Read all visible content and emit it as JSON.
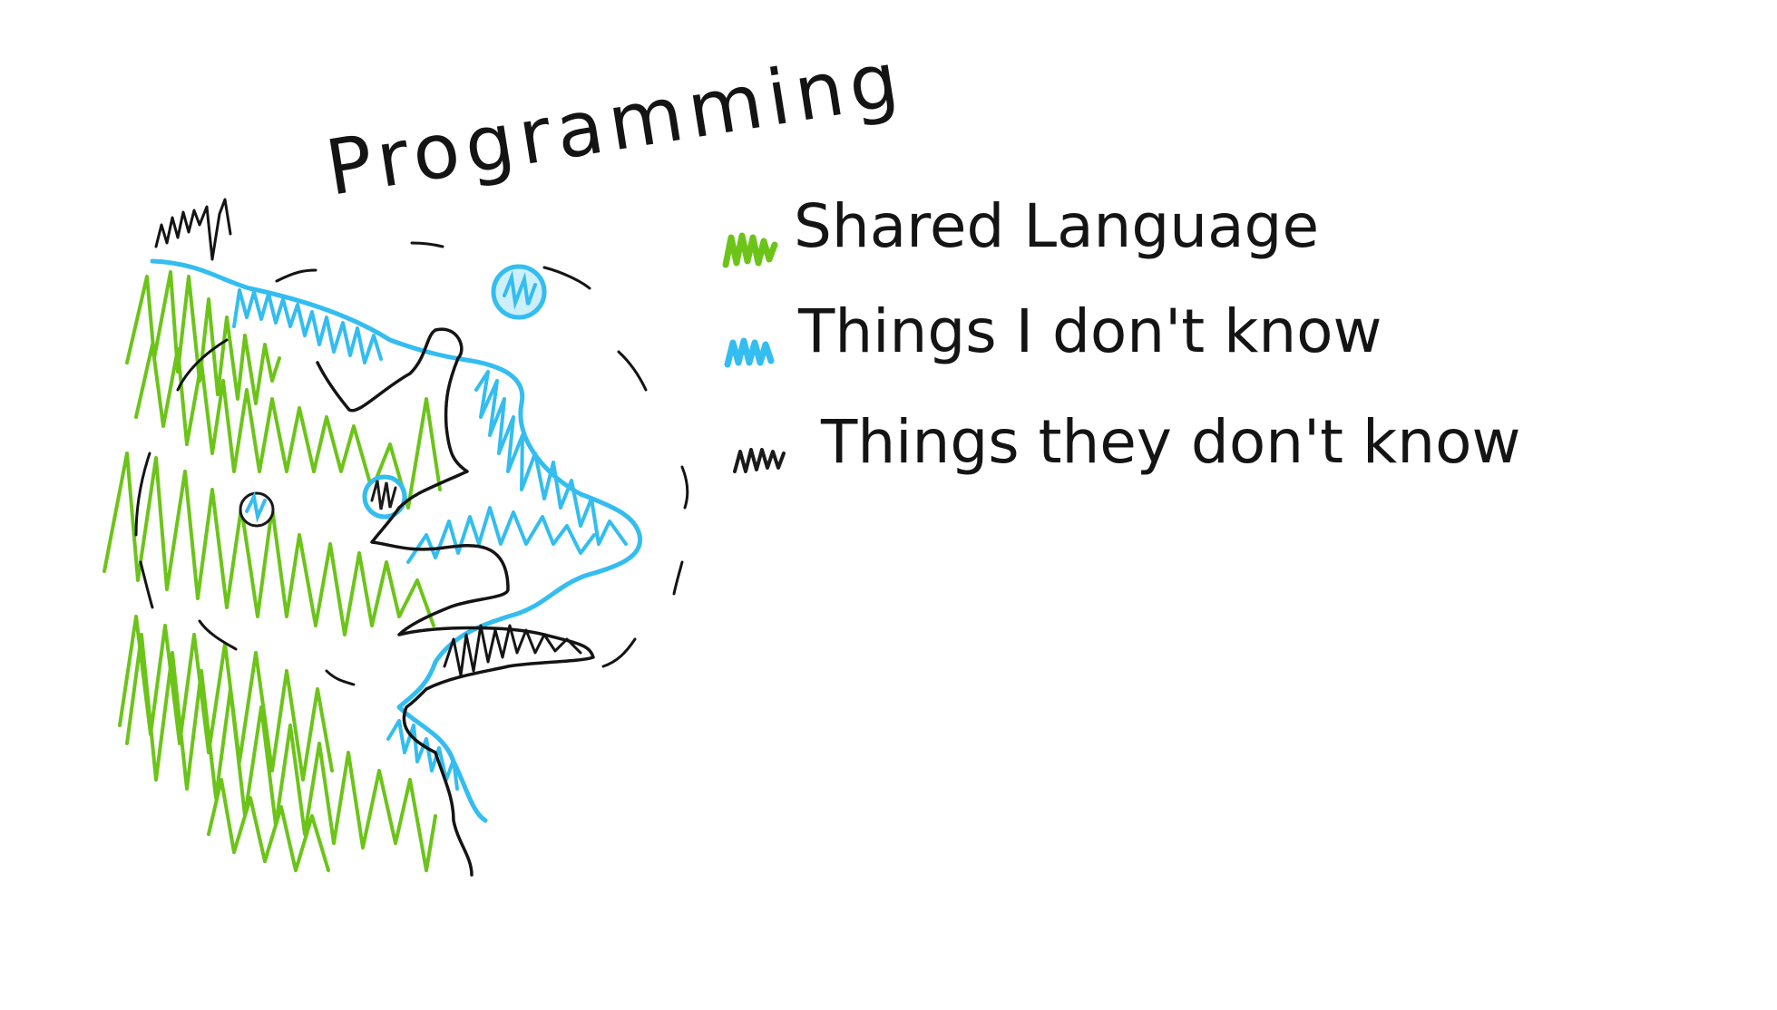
{
  "title": "Programming",
  "legend": [
    {
      "label": "Shared Language",
      "swatch_color": "#6cc419"
    },
    {
      "label": "Things I don't know",
      "swatch_color": "#33bdf0"
    },
    {
      "label": "Things they don't know",
      "swatch_color": "#1a1a1a"
    }
  ],
  "colors": {
    "ink": "#141414",
    "shared_language": "#6cc419",
    "unknown_to_me": "#33bdf0",
    "unknown_to_them": "#1a1a1a",
    "background": "#ffffff"
  }
}
